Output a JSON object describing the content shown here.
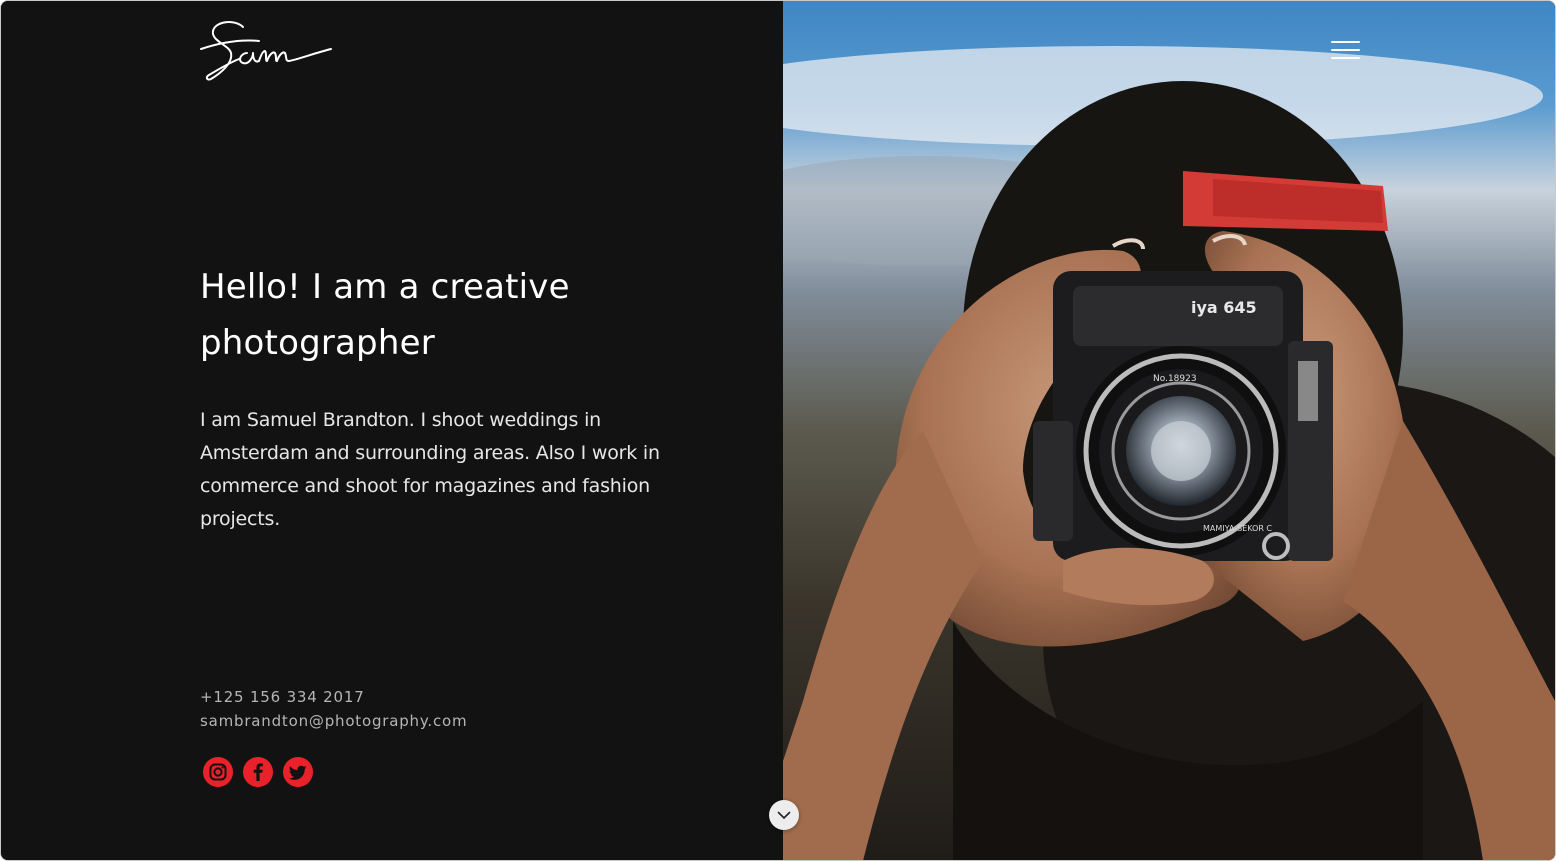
{
  "header": {
    "logo_alt": "Sam",
    "menu_icon": "hamburger-icon"
  },
  "hero": {
    "headline_line1": "Hello! I am a creative",
    "headline_line2": "photographer",
    "intro_line1": "I am Samuel Brandton. I shoot weddings in",
    "intro_line2": "Amsterdam and surrounding areas. Also I work in",
    "intro_line3": "commerce and shoot for magazines and fashion",
    "intro_line4": "projects."
  },
  "contact": {
    "phone": "+125 156 334 2017",
    "email": "sambrandton@photography.com"
  },
  "social": [
    {
      "name": "instagram",
      "icon": "instagram-icon"
    },
    {
      "name": "facebook",
      "icon": "facebook-icon"
    },
    {
      "name": "twitter",
      "icon": "twitter-icon"
    }
  ],
  "photo": {
    "lens_text": "iya 645",
    "lens_ring_text": "MAMIYA-SEKOR C",
    "lens_spec_text": "No.18923"
  },
  "scroll_icon": "chevron-down-icon",
  "colors": {
    "background": "#121212",
    "accent": "#e8212a",
    "text": "#ffffff"
  }
}
